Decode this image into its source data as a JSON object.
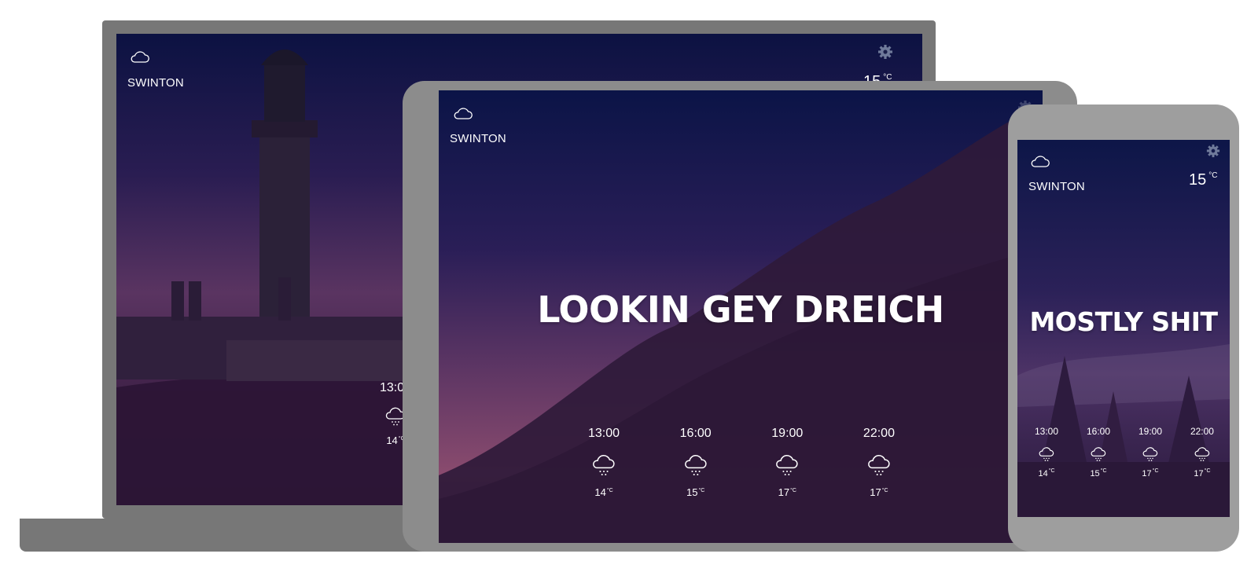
{
  "colors": {
    "text": "#ffffff",
    "gear": "#6f7a9a",
    "frame_laptop": "#777777",
    "frame_tablet": "#8c8c8c",
    "frame_phone": "#9e9e9e"
  },
  "laptop": {
    "location": "SWINTON",
    "current_temp": "15",
    "temp_unit": "°C",
    "weather_icon": "cloud-icon",
    "settings_icon": "gear-icon",
    "forecast": [
      {
        "time": "13:00",
        "icon": "rain-cloud-icon",
        "temp": "14",
        "unit": "°C"
      }
    ]
  },
  "tablet": {
    "location": "SWINTON",
    "weather_icon": "cloud-icon",
    "settings_icon": "gear-icon",
    "headline": "LOOKIN GEY DREICH",
    "forecast": [
      {
        "time": "13:00",
        "icon": "rain-cloud-icon",
        "temp": "14",
        "unit": "°C"
      },
      {
        "time": "16:00",
        "icon": "rain-cloud-icon",
        "temp": "15",
        "unit": "°C"
      },
      {
        "time": "19:00",
        "icon": "rain-cloud-icon",
        "temp": "17",
        "unit": "°C"
      },
      {
        "time": "22:00",
        "icon": "rain-cloud-icon",
        "temp": "17",
        "unit": "°C"
      }
    ]
  },
  "phone": {
    "location": "SWINTON",
    "current_temp": "15",
    "temp_unit": "°C",
    "weather_icon": "cloud-icon",
    "settings_icon": "gear-icon",
    "headline": "MOSTLY SHIT",
    "forecast": [
      {
        "time": "13:00",
        "icon": "rain-cloud-icon",
        "temp": "14",
        "unit": "°C"
      },
      {
        "time": "16:00",
        "icon": "rain-cloud-icon",
        "temp": "15",
        "unit": "°C"
      },
      {
        "time": "19:00",
        "icon": "rain-cloud-icon",
        "temp": "17",
        "unit": "°C"
      },
      {
        "time": "22:00",
        "icon": "rain-cloud-icon",
        "temp": "17",
        "unit": "°C"
      }
    ]
  }
}
